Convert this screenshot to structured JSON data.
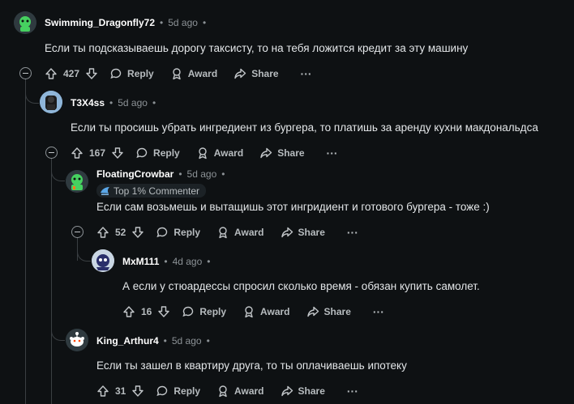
{
  "comments": [
    {
      "author": "Swimming_Dragonfly72",
      "time": "5d ago",
      "text": "Если ты подсказываешь дорогу таксисту, то на тебя ложится кредит за эту машину",
      "score": "427",
      "reply": "Reply",
      "award": "Award",
      "share": "Share"
    },
    {
      "author": "T3X4ss",
      "time": "5d ago",
      "text": "Если ты просишь убрать ингредиент из бургера, то платишь за аренду кухни макдональдса",
      "score": "167",
      "reply": "Reply",
      "award": "Award",
      "share": "Share"
    },
    {
      "author": "FloatingCrowbar",
      "time": "5d ago",
      "badge": "Top 1% Commenter",
      "text": "Если сам возьмешь и вытащишь этот ингридиент и готового бургера - тоже :)",
      "score": "52",
      "reply": "Reply",
      "award": "Award",
      "share": "Share"
    },
    {
      "author": "MxM111",
      "time": "4d ago",
      "text": "А если у стюардессы спросил сколько время - обязан купить самолет.",
      "score": "16",
      "reply": "Reply",
      "award": "Award",
      "share": "Share"
    },
    {
      "author": "King_Arthur4",
      "time": "5d ago",
      "text": "Если ты зашел в квартиру друга, то ты оплачиваешь ипотеку",
      "score": "31",
      "reply": "Reply",
      "award": "Award",
      "share": "Share"
    }
  ],
  "separator": "•",
  "more_glyph": "···",
  "colors": {
    "background": "#0e1113",
    "thread_line": "#3a3f42",
    "text": "#e3e6e8",
    "meta": "#8c9296"
  }
}
